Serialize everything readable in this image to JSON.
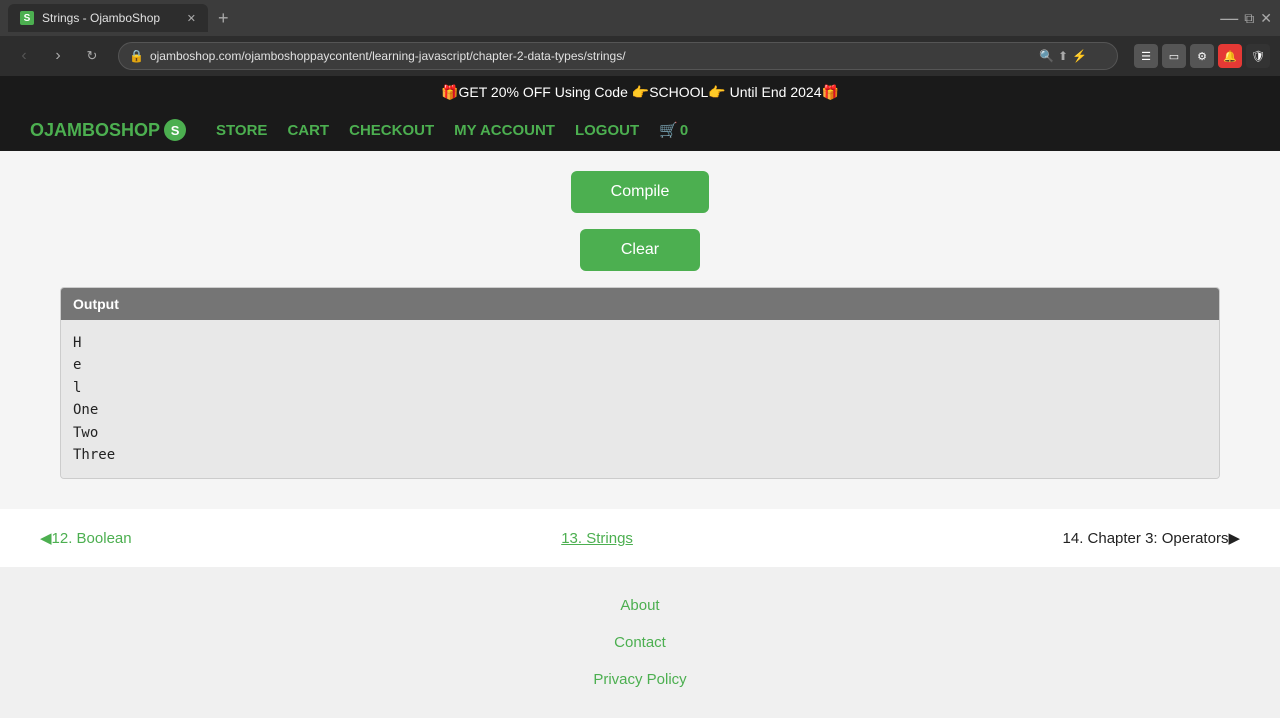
{
  "browser": {
    "tab_title": "Strings - OjamboShop",
    "tab_favicon_letter": "S",
    "url": "ojamboshop.com/ojamboshoppaycontent/learning-javascript/chapter-2-data-types/strings/",
    "new_tab_label": "+",
    "back_disabled": false,
    "forward_disabled": true
  },
  "promo": {
    "text": "🎁GET 20% OFF Using Code 👉SCHOOL👉 Until End 2024🎁"
  },
  "nav": {
    "logo_text": "OJAMBOSHOP",
    "logo_s": "S",
    "store": "STORE",
    "cart": "CART",
    "checkout": "CHECKOUT",
    "my_account": "MY ACCOUNT",
    "logout": "LOGOUT",
    "cart_count": "0"
  },
  "buttons": {
    "compile": "Compile",
    "clear": "Clear"
  },
  "output": {
    "header": "Output",
    "lines": [
      "H",
      "e",
      "l",
      "One",
      "Two",
      "Three"
    ]
  },
  "navigation": {
    "prev_label": "◀12. Boolean",
    "current_label": "13. Strings",
    "next_label": "14. Chapter 3: Operators▶"
  },
  "footer": {
    "about": "About",
    "contact": "Contact",
    "privacy_policy": "Privacy Policy"
  }
}
